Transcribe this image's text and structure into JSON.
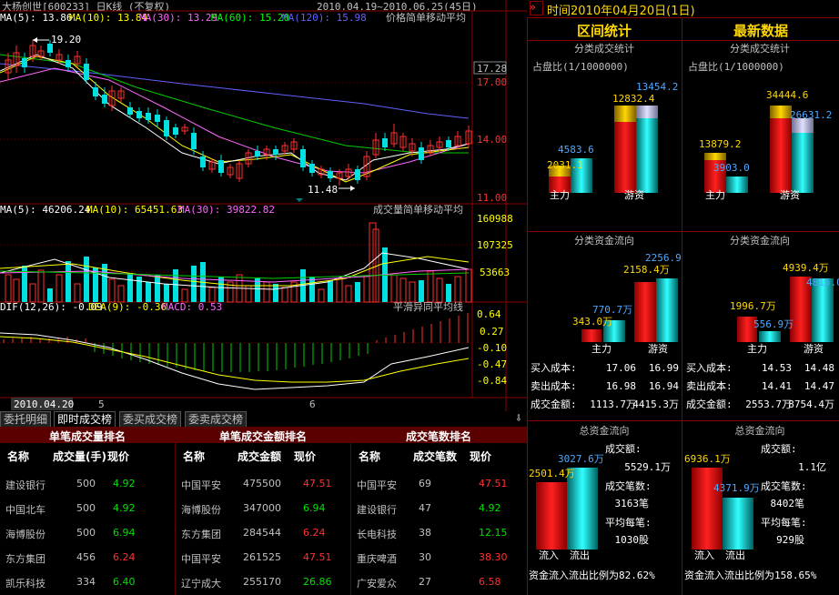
{
  "chart": {
    "title": "大杨创世[600233] 日K线 (不复权)",
    "date_range": "2010.04.19~2010.06.25(45日)",
    "ma_labels": [
      {
        "text": "MA(5): 13.86",
        "color": "#ffffff"
      },
      {
        "text": "MA(10): 13.84",
        "color": "#ffff00"
      },
      {
        "text": "MA(30): 13.29",
        "color": "#ff66ff"
      },
      {
        "text": "MA(60): 15.20",
        "color": "#00ff00"
      },
      {
        "text": "MA(120): 15.98",
        "color": "#6060ff"
      }
    ],
    "ma_caption": "价格简单移动平均",
    "price_axis": [
      "17.28",
      "17.00",
      "14.00",
      "11.00"
    ],
    "high_label": "19.20",
    "low_label": "11.48",
    "vol_labels": [
      {
        "text": "MA(5): 46206.24",
        "color": "#ffffff"
      },
      {
        "text": "MA(10): 65451.63",
        "color": "#ffff00"
      },
      {
        "text": "MA(30): 39822.82",
        "color": "#ff66ff"
      }
    ],
    "vol_caption": "成交量简单移动平均",
    "vol_axis": [
      "160988",
      "107325",
      "53663"
    ],
    "macd_labels": [
      {
        "text": "DIF(12,26): -0.09",
        "color": "#ffffff"
      },
      {
        "text": "DEA(9): -0.36",
        "color": "#ffff00"
      },
      {
        "text": "MACD: 0.53",
        "color": "#ff66ff"
      }
    ],
    "macd_caption": "平滑异同平均线",
    "macd_axis": [
      "0.64",
      "0.27",
      "-0.10",
      "-0.47",
      "-0.84"
    ],
    "date_bar": {
      "current": "2010.04.20",
      "m1": "5",
      "m2": "6"
    }
  },
  "tabs": [
    "委托明细",
    "即时成交榜",
    "委买成交榜",
    "委卖成交榜"
  ],
  "tables": {
    "t1": {
      "title": "单笔成交量排名",
      "headers": [
        "名称",
        "成交量(手)",
        "现价"
      ],
      "rows": [
        [
          "建设银行",
          "500",
          "4.92"
        ],
        [
          "中国北车",
          "500",
          "4.92"
        ],
        [
          "海博股份",
          "500",
          "6.94"
        ],
        [
          "东方集团",
          "456",
          "6.24"
        ],
        [
          "凯乐科技",
          "334",
          "6.40"
        ]
      ]
    },
    "t2": {
      "title": "单笔成交金额排名",
      "headers": [
        "名称",
        "成交金额",
        "现价"
      ],
      "rows": [
        [
          "中国平安",
          "475500",
          "47.51"
        ],
        [
          "海博股份",
          "347000",
          "6.94"
        ],
        [
          "东方集团",
          "284544",
          "6.24"
        ],
        [
          "中国平安",
          "261525",
          "47.51"
        ],
        [
          "辽宁成大",
          "255170",
          "26.86"
        ]
      ]
    },
    "t3": {
      "title": "成交笔数排名",
      "headers": [
        "名称",
        "成交笔数",
        "现价"
      ],
      "rows": [
        [
          "中国平安",
          "69",
          "47.51"
        ],
        [
          "建设银行",
          "47",
          "4.92"
        ],
        [
          "长电科技",
          "38",
          "12.15"
        ],
        [
          "重庆啤酒",
          "30",
          "38.30"
        ],
        [
          "广安爱众",
          "27",
          "6.58"
        ]
      ]
    }
  },
  "right": {
    "time_label": "时间:",
    "time_value": "2010年04月20日(1日)",
    "left_title": "区间统计",
    "right_title": "最新数据",
    "vol_sub": "分类成交统计",
    "ratio_label": "占盘比(1/1000000)",
    "zhuli": "主力",
    "youzi": "游资",
    "left_vol": {
      "zl_a": "2031.1",
      "zl_b": "4583.6",
      "yz_a": "12832.4",
      "yz_b": "13454.2"
    },
    "right_vol": {
      "zl_a": "13879.2",
      "zl_b": "3903.0",
      "yz_a": "34444.6",
      "yz_b": "26631.2"
    },
    "flow_sub": "分类资金流向",
    "left_flow": {
      "zl_a": "343.0万",
      "zl_b": "770.7万",
      "yz_a": "2158.4万",
      "yz_b": "2256.9"
    },
    "right_flow": {
      "zl_a": "1996.7万",
      "zl_b": "556.9万",
      "yz_a": "4939.4万",
      "yz_b": "4815.0"
    },
    "cost_labels": [
      "买入成本:",
      "卖出成本:",
      "成交金额:"
    ],
    "left_cost": [
      [
        "17.06",
        "16.99"
      ],
      [
        "16.98",
        "16.94"
      ],
      [
        "1113.7万",
        "4415.3万"
      ]
    ],
    "right_cost": [
      [
        "14.53",
        "14.48"
      ],
      [
        "14.41",
        "14.47"
      ],
      [
        "2553.7万",
        "8754.4万"
      ]
    ],
    "total_sub": "总资金流向",
    "in_label": "流入",
    "out_label": "流出",
    "left_total": {
      "in": "2501.4万",
      "out": "3027.6万",
      "amt_label": "成交额:",
      "amt": "5529.1万",
      "cnt_label": "成交笔数:",
      "cnt": "3163笔",
      "avg_label": "平均每笔:",
      "avg": "1030股",
      "ratio": "资金流入流出比例为82.62%"
    },
    "right_total": {
      "in": "6936.1万",
      "out": "4371.9万",
      "amt_label": "成交额:",
      "amt": "1.1亿",
      "cnt_label": "成交笔数:",
      "cnt": "8402笔",
      "avg_label": "平均每笔:",
      "avg": "929股",
      "ratio": "资金流入流出比例为158.65%"
    }
  }
}
